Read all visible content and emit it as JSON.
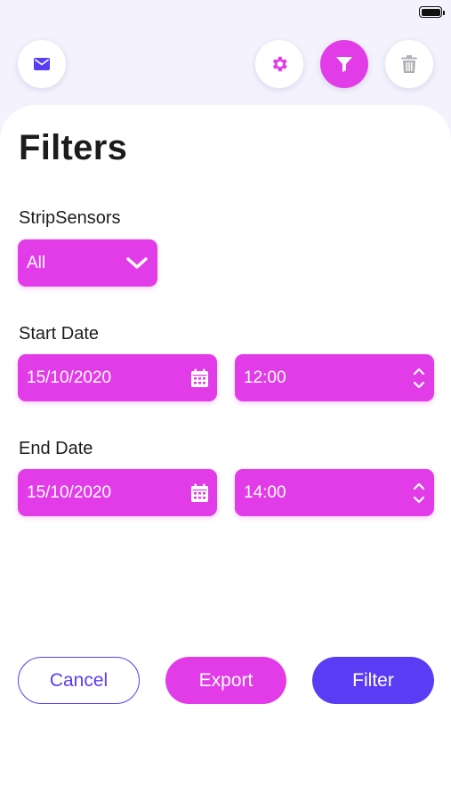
{
  "header": {
    "icons": [
      "mail-icon",
      "gear-icon",
      "filter-icon",
      "trash-icon"
    ]
  },
  "page": {
    "title": "Filters"
  },
  "strip_sensors": {
    "label": "StripSensors",
    "selected": "All"
  },
  "start_date": {
    "label": "Start Date",
    "date": "15/10/2020",
    "time": "12:00"
  },
  "end_date": {
    "label": "End Date",
    "date": "15/10/2020",
    "time": "14:00"
  },
  "actions": {
    "cancel": "Cancel",
    "export": "Export",
    "filter": "Filter"
  },
  "colors": {
    "magenta": "#e23ce8",
    "violet": "#5b3cf5",
    "background": "#f4f3fd"
  }
}
